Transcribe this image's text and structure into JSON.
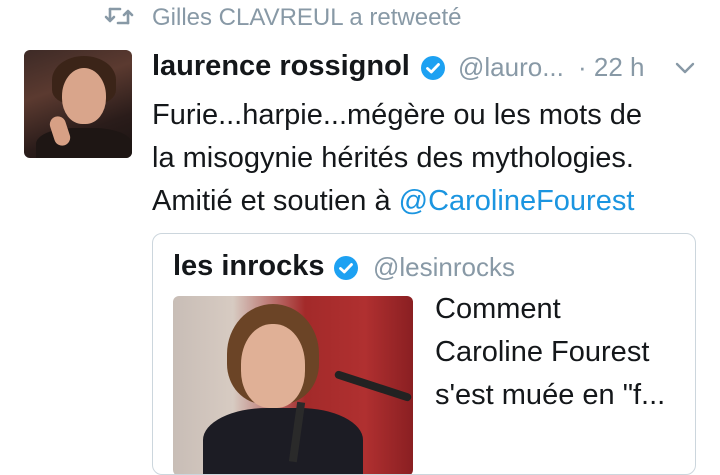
{
  "retweet": {
    "text": "Gilles CLAVREUL a retweeté",
    "icon": "retweet-icon"
  },
  "tweet": {
    "author_name": "laurence rossignol",
    "handle": "@lauro...",
    "time": "· 22 h",
    "verified": true,
    "text_lines": [
      "Furie...harpie...mégère ou les mots de",
      "la misogynie hérités des mythologies.",
      "Amitié et soutien à "
    ],
    "mention": "@CarolineFourest"
  },
  "quote": {
    "author_name": "les inrocks",
    "handle": "@lesinrocks",
    "verified": true,
    "desc_lines": [
      "Comment",
      "Caroline Fourest",
      "s'est muée en \"f..."
    ]
  },
  "colors": {
    "link": "#1b95e0",
    "muted": "#8899a6",
    "verified": "#1da1f2"
  }
}
